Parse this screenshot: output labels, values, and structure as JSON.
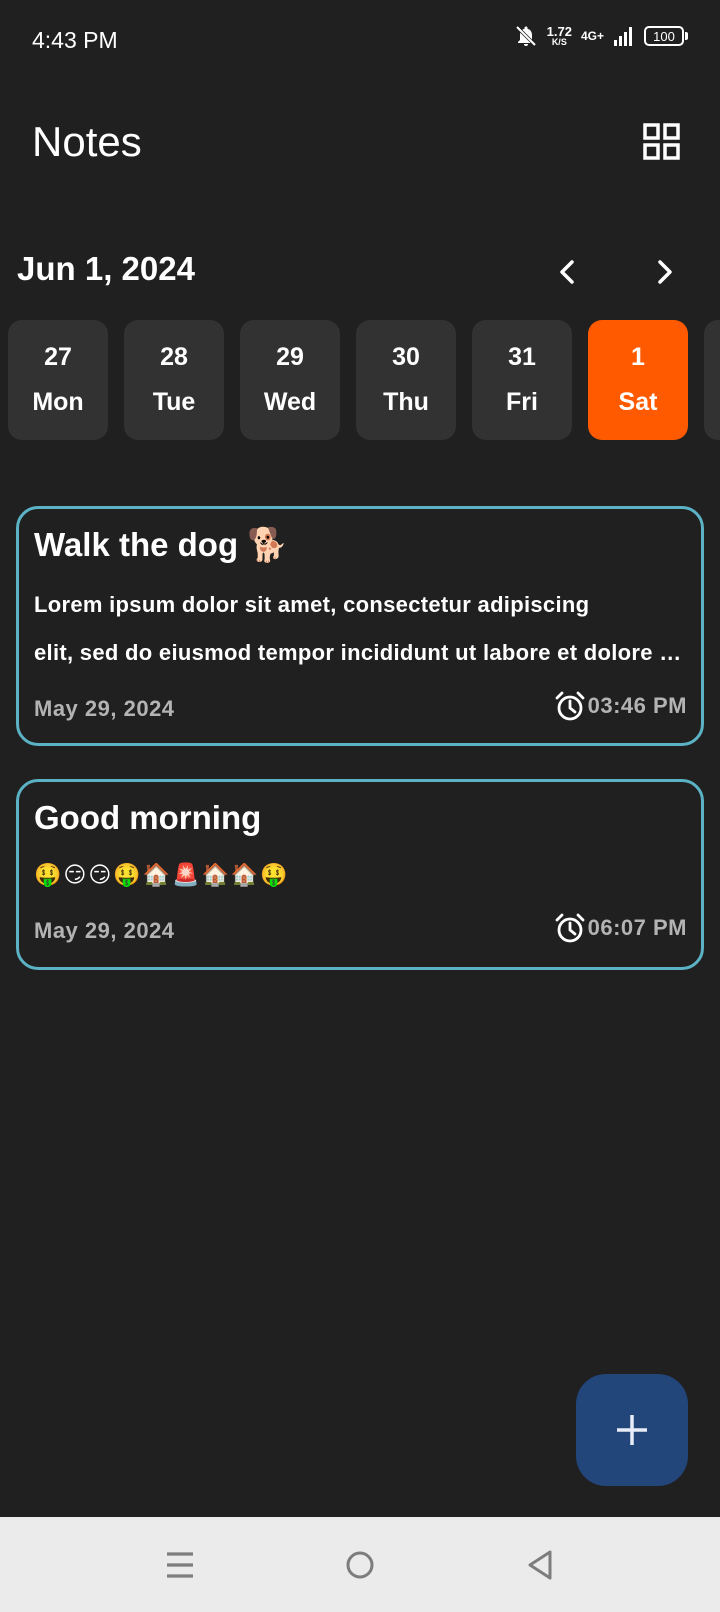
{
  "status_bar": {
    "time": "4:43 PM",
    "net_speed_value": "1.72",
    "net_speed_unit": "K/S",
    "network_type": "4G+",
    "battery": "100"
  },
  "header": {
    "title": "Notes",
    "view_toggle_icon": "grid-view-icon"
  },
  "date_nav": {
    "current_date": "Jun 1, 2024",
    "prev_icon": "chevron-left-icon",
    "next_icon": "chevron-right-icon"
  },
  "days": [
    {
      "num": "27",
      "weekday": "Mon",
      "selected": false
    },
    {
      "num": "28",
      "weekday": "Tue",
      "selected": false
    },
    {
      "num": "29",
      "weekday": "Wed",
      "selected": false
    },
    {
      "num": "30",
      "weekday": "Thu",
      "selected": false
    },
    {
      "num": "31",
      "weekday": "Fri",
      "selected": false
    },
    {
      "num": "1",
      "weekday": "Sat",
      "selected": true
    }
  ],
  "notes": [
    {
      "title": "Walk the dog 🐕",
      "body_line1": "Lorem ipsum dolor sit amet, consectetur adipiscing",
      "body_line2": "elit, sed do eiusmod tempor incididunt ut labore et dolore magna aliqua",
      "date": "May 29, 2024",
      "time": "03:46 PM"
    },
    {
      "title": "Good morning",
      "body_line1": "🤑😏😏🤑🏠🚨🏠🏠🤑",
      "date": "May 29, 2024",
      "time": "06:07 PM"
    }
  ],
  "fab": {
    "icon": "plus-icon"
  },
  "nav_bar": {
    "icons": [
      "menu-icon",
      "home-circle-icon",
      "back-triangle-icon"
    ]
  },
  "colors": {
    "background": "#202020",
    "day_chip": "#323232",
    "selected_day": "#ff5a00",
    "card_border": "#5bb2c4",
    "fab": "#22457a",
    "muted_text": "#b3b3b3"
  }
}
